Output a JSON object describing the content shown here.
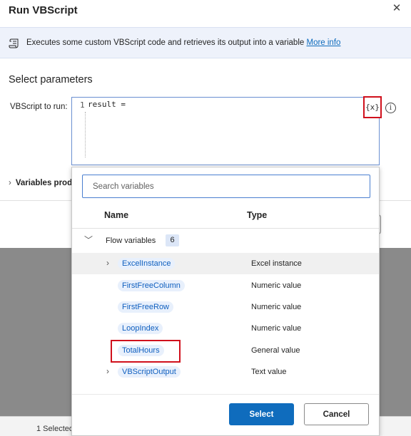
{
  "dialog": {
    "title": "Run VBScript",
    "close_symbol": "✕",
    "info": {
      "icon": "script-icon",
      "text": "Executes some custom VBScript code and retrieves its output into a variable",
      "link": "More info"
    },
    "section_title": "Select parameters",
    "param_label": "VBScript to run:",
    "editor": {
      "line_number": "1",
      "content": "result ="
    },
    "var_button": "{x}",
    "param_info_icon": "i",
    "variables_produced": "Variables prod",
    "variables_produced_icon": "chevron-right-icon"
  },
  "background_status": "1 Selected",
  "variables_popup": {
    "search_placeholder": "Search variables",
    "columns": {
      "name": "Name",
      "type": "Type"
    },
    "group": {
      "label": "Flow variables",
      "count": "6",
      "expanded": true
    },
    "variables": [
      {
        "name": "ExcelInstance",
        "type": "Excel instance",
        "expandable": true,
        "hovered": true
      },
      {
        "name": "FirstFreeColumn",
        "type": "Numeric value",
        "expandable": false,
        "hovered": false
      },
      {
        "name": "FirstFreeRow",
        "type": "Numeric value",
        "expandable": false,
        "hovered": false
      },
      {
        "name": "LoopIndex",
        "type": "Numeric value",
        "expandable": false,
        "hovered": false
      },
      {
        "name": "TotalHours",
        "type": "General value",
        "expandable": false,
        "hovered": false
      },
      {
        "name": "VBScriptOutput",
        "type": "Text value",
        "expandable": true,
        "hovered": false
      }
    ],
    "buttons": {
      "select": "Select",
      "cancel": "Cancel"
    }
  },
  "colors": {
    "accent": "#0f6cbd",
    "highlight_box": "#d0101c",
    "chip_bg": "#e8f0fc",
    "overlay": "#8a8a8a"
  }
}
